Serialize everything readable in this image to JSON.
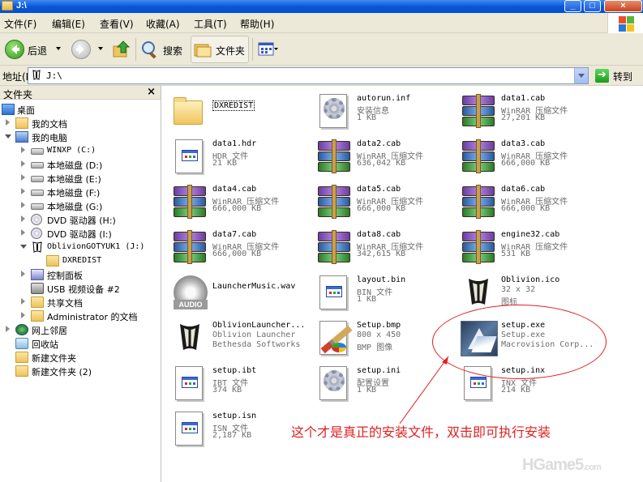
{
  "window": {
    "title": "J:\\"
  },
  "menu": [
    "文件(F)",
    "编辑(E)",
    "查看(V)",
    "收藏(A)",
    "工具(T)",
    "帮助(H)"
  ],
  "toolbar": {
    "back_label": "后退",
    "search_label": "搜索",
    "folders_label": "文件夹"
  },
  "address": {
    "label": "地址(D)",
    "value": "J:\\",
    "go_label": "转到"
  },
  "folders_pane": {
    "title": "文件夹",
    "close_glyph": "×",
    "items": [
      {
        "label": "桌面",
        "icon": "desktop-icon"
      },
      {
        "label": "我的文档",
        "icon": "my-documents-icon"
      },
      {
        "label": "我的电脑",
        "icon": "my-computer-icon"
      },
      {
        "label": "WINXP (C:)",
        "icon": "drive-icon"
      },
      {
        "label": "本地磁盘 (D:)",
        "icon": "drive-icon"
      },
      {
        "label": "本地磁盘 (E:)",
        "icon": "drive-icon"
      },
      {
        "label": "本地磁盘 (F:)",
        "icon": "drive-icon"
      },
      {
        "label": "本地磁盘 (G:)",
        "icon": "drive-icon"
      },
      {
        "label": "DVD 驱动器 (H:)",
        "icon": "dvd-drive-icon"
      },
      {
        "label": "DVD 驱动器 (I:)",
        "icon": "dvd-drive-icon"
      },
      {
        "label": "OblivionGOTYUK1 (J:)",
        "icon": "oblivion-disc-icon"
      },
      {
        "label": "DXREDIST",
        "icon": "folder-icon"
      },
      {
        "label": "控制面板",
        "icon": "control-panel-icon"
      },
      {
        "label": "USB 视频设备 #2",
        "icon": "usb-camera-icon"
      },
      {
        "label": "共享文档",
        "icon": "folder-icon"
      },
      {
        "label": "Administrator 的文档",
        "icon": "folder-icon"
      },
      {
        "label": "网上邻居",
        "icon": "network-icon"
      },
      {
        "label": "回收站",
        "icon": "recycle-bin-icon"
      },
      {
        "label": "新建文件夹",
        "icon": "folder-icon"
      },
      {
        "label": "新建文件夹 (2)",
        "icon": "folder-icon"
      }
    ]
  },
  "files": [
    {
      "name": "DXREDIST",
      "type": "",
      "size": "",
      "icon": "folder-icon"
    },
    {
      "name": "autorun.inf",
      "type": "安装信息",
      "size": "1 KB",
      "icon": "setup-info-icon"
    },
    {
      "name": "data1.cab",
      "type": "WinRAR 压缩文件",
      "size": "27,201 KB",
      "icon": "winrar-icon"
    },
    {
      "name": "data1.hdr",
      "type": "HDR 文件",
      "size": "21 KB",
      "icon": "generic-file-icon"
    },
    {
      "name": "data2.cab",
      "type": "WinRAR 压缩文件",
      "size": "636,042 KB",
      "icon": "winrar-icon"
    },
    {
      "name": "data3.cab",
      "type": "WinRAR 压缩文件",
      "size": "666,000 KB",
      "icon": "winrar-icon"
    },
    {
      "name": "data4.cab",
      "type": "WinRAR 压缩文件",
      "size": "666,000 KB",
      "icon": "winrar-icon"
    },
    {
      "name": "data5.cab",
      "type": "WinRAR 压缩文件",
      "size": "666,000 KB",
      "icon": "winrar-icon"
    },
    {
      "name": "data6.cab",
      "type": "WinRAR 压缩文件",
      "size": "666,000 KB",
      "icon": "winrar-icon"
    },
    {
      "name": "data7.cab",
      "type": "WinRAR 压缩文件",
      "size": "666,000 KB",
      "icon": "winrar-icon"
    },
    {
      "name": "data8.cab",
      "type": "WinRAR 压缩文件",
      "size": "342,615 KB",
      "icon": "winrar-icon"
    },
    {
      "name": "engine32.cab",
      "type": "WinRAR 压缩文件",
      "size": "531 KB",
      "icon": "winrar-icon"
    },
    {
      "name": "LauncherMusic.wav",
      "type": "",
      "size": "",
      "icon": "audio-icon"
    },
    {
      "name": "layout.bin",
      "type": "BIN 文件",
      "size": "1 KB",
      "icon": "generic-file-icon"
    },
    {
      "name": "Oblivion.ico",
      "type": "32 x 32",
      "size": "图标",
      "icon": "oblivion-icon"
    },
    {
      "name": "OblivionLauncher...",
      "type": "Oblivion Launcher",
      "size": "Bethesda Softworks",
      "icon": "oblivion-icon"
    },
    {
      "name": "Setup.bmp",
      "type": "800 x 450",
      "size": "BMP 图像",
      "icon": "paint-icon"
    },
    {
      "name": "setup.exe",
      "type": "Setup.exe",
      "size": "Macrovision Corp...",
      "icon": "installer-icon"
    },
    {
      "name": "setup.ibt",
      "type": "IBT 文件",
      "size": "374 KB",
      "icon": "generic-file-icon"
    },
    {
      "name": "setup.ini",
      "type": "配置设置",
      "size": "1 KB",
      "icon": "config-settings-icon"
    },
    {
      "name": "setup.inx",
      "type": "INX 文件",
      "size": "214 KB",
      "icon": "generic-file-icon"
    },
    {
      "name": "setup.isn",
      "type": "ISN 文件",
      "size": "2,187 KB",
      "icon": "generic-file-icon"
    }
  ],
  "annotation": {
    "text": "这个才是真正的安装文件，双击即可执行安装",
    "color": "#e02020"
  },
  "watermark": {
    "text": "HGame5",
    "suffix": ".com"
  }
}
